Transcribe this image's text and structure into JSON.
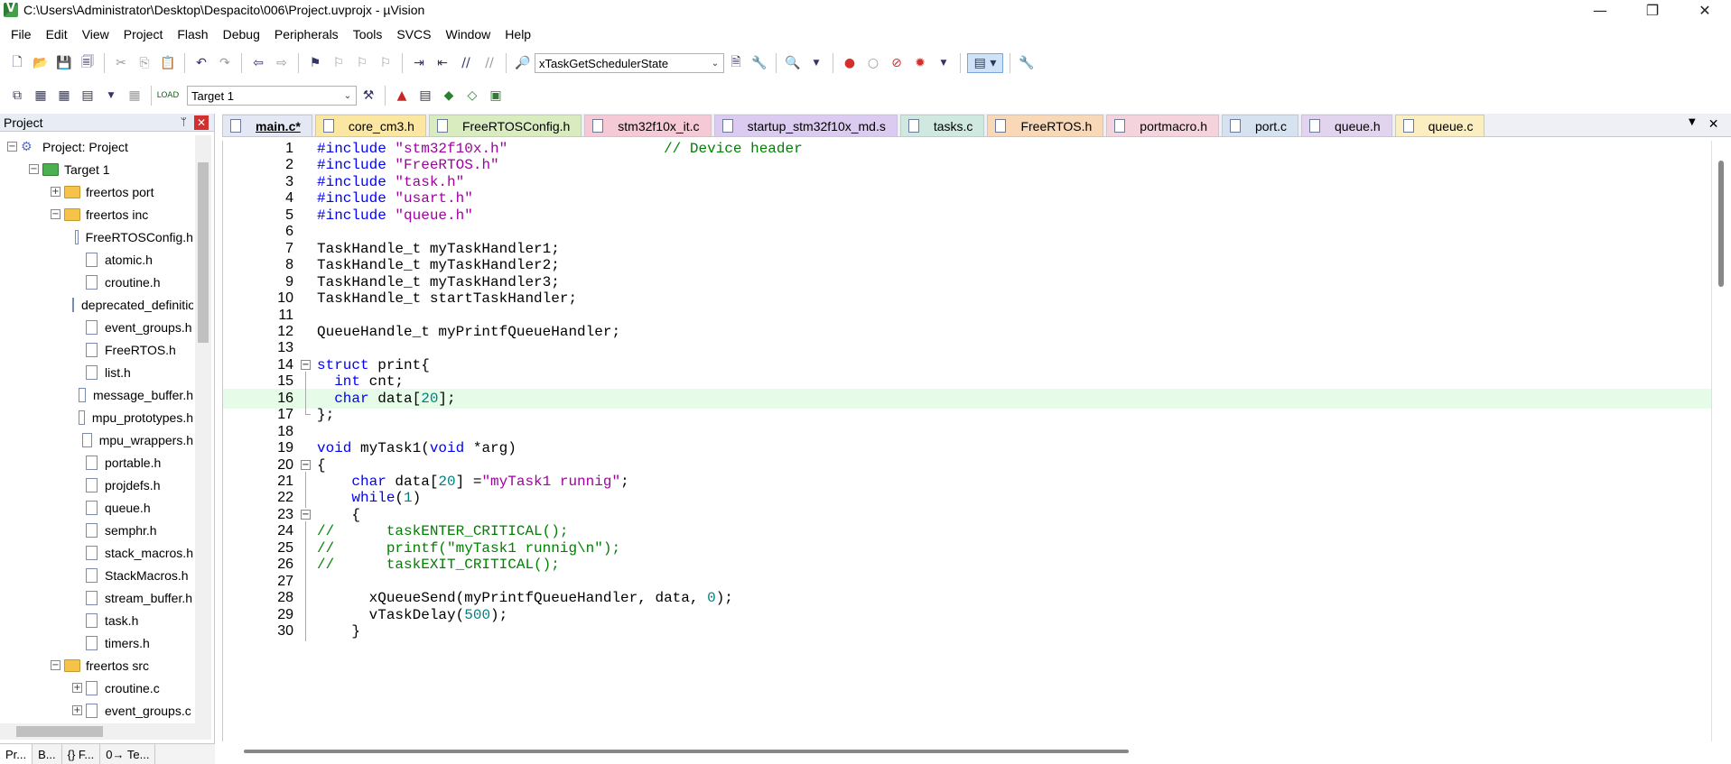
{
  "window": {
    "title": "C:\\Users\\Administrator\\Desktop\\Despacito\\006\\Project.uvprojx - µVision",
    "minimize": "—",
    "maximize": "❐",
    "close": "✕"
  },
  "menu": [
    "File",
    "Edit",
    "View",
    "Project",
    "Flash",
    "Debug",
    "Peripherals",
    "Tools",
    "SVCS",
    "Window",
    "Help"
  ],
  "toolbar": {
    "function_combo": "xTaskGetSchedulerState",
    "target_combo": "Target 1"
  },
  "project_panel": {
    "title": "Project",
    "pin": "ᛘ",
    "close": "✕",
    "tree": [
      {
        "label": "Project: Project",
        "type": "project",
        "indent": 0,
        "expander": "⊟"
      },
      {
        "label": "Target 1",
        "type": "target",
        "indent": 1,
        "expander": "⊟"
      },
      {
        "label": "freertos port",
        "type": "folder",
        "indent": 2,
        "expander": "+"
      },
      {
        "label": "freertos inc",
        "type": "folder",
        "indent": 2,
        "expander": "−"
      },
      {
        "label": "FreeRTOSConfig.h",
        "type": "file",
        "indent": 3
      },
      {
        "label": "atomic.h",
        "type": "file",
        "indent": 3
      },
      {
        "label": "croutine.h",
        "type": "file",
        "indent": 3
      },
      {
        "label": "deprecated_definitions.h",
        "type": "file",
        "indent": 3
      },
      {
        "label": "event_groups.h",
        "type": "file",
        "indent": 3
      },
      {
        "label": "FreeRTOS.h",
        "type": "file",
        "indent": 3
      },
      {
        "label": "list.h",
        "type": "file",
        "indent": 3
      },
      {
        "label": "message_buffer.h",
        "type": "file",
        "indent": 3
      },
      {
        "label": "mpu_prototypes.h",
        "type": "file",
        "indent": 3
      },
      {
        "label": "mpu_wrappers.h",
        "type": "file",
        "indent": 3
      },
      {
        "label": "portable.h",
        "type": "file",
        "indent": 3
      },
      {
        "label": "projdefs.h",
        "type": "file",
        "indent": 3
      },
      {
        "label": "queue.h",
        "type": "file",
        "indent": 3
      },
      {
        "label": "semphr.h",
        "type": "file",
        "indent": 3
      },
      {
        "label": "stack_macros.h",
        "type": "file",
        "indent": 3
      },
      {
        "label": "StackMacros.h",
        "type": "file",
        "indent": 3
      },
      {
        "label": "stream_buffer.h",
        "type": "file",
        "indent": 3
      },
      {
        "label": "task.h",
        "type": "file",
        "indent": 3
      },
      {
        "label": "timers.h",
        "type": "file",
        "indent": 3
      },
      {
        "label": "freertos src",
        "type": "folder",
        "indent": 2,
        "expander": "−"
      },
      {
        "label": "croutine.c",
        "type": "file",
        "indent": 3,
        "expander": "+"
      },
      {
        "label": "event_groups.c",
        "type": "file",
        "indent": 3,
        "expander": "+"
      }
    ],
    "bottom_tabs": [
      "Pr...",
      "B...",
      "{} F...",
      "0→ Te..."
    ]
  },
  "editor_tabs": [
    {
      "label": "main.c*",
      "color": "#e3e8f4",
      "active": true
    },
    {
      "label": "core_cm3.h",
      "color": "#fbe7a1",
      "active": false
    },
    {
      "label": "FreeRTOSConfig.h",
      "color": "#d9ecc0",
      "active": false
    },
    {
      "label": "stm32f10x_it.c",
      "color": "#f6c9d6",
      "active": false
    },
    {
      "label": "startup_stm32f10x_md.s",
      "color": "#dccbf0",
      "active": false
    },
    {
      "label": "tasks.c",
      "color": "#cfe8e0",
      "active": false
    },
    {
      "label": "FreeRTOS.h",
      "color": "#f9d8b8",
      "active": false
    },
    {
      "label": "portmacro.h",
      "color": "#f5d3dd",
      "active": false
    },
    {
      "label": "port.c",
      "color": "#d6e2f0",
      "active": false
    },
    {
      "label": "queue.h",
      "color": "#e2d4ee",
      "active": false
    },
    {
      "label": "queue.c",
      "color": "#fbeec0",
      "active": false
    }
  ],
  "tab_controls": {
    "dropdown": "▼",
    "close": "✕"
  },
  "code": [
    {
      "n": "1",
      "fold": "",
      "html": "<span class='pp'>#include</span> <span class='str'>\"stm32f10x.h\"</span>                  <span class='cmt'>// Device header</span>"
    },
    {
      "n": "2",
      "fold": "",
      "html": "<span class='pp'>#include</span> <span class='str'>\"FreeRTOS.h\"</span>"
    },
    {
      "n": "3",
      "fold": "",
      "html": "<span class='pp'>#include</span> <span class='str'>\"task.h\"</span>"
    },
    {
      "n": "4",
      "fold": "",
      "html": "<span class='pp'>#include</span> <span class='str'>\"usart.h\"</span>"
    },
    {
      "n": "5",
      "fold": "",
      "html": "<span class='pp'>#include</span> <span class='str'>\"queue.h\"</span>"
    },
    {
      "n": "6",
      "fold": "",
      "html": ""
    },
    {
      "n": "7",
      "fold": "",
      "html": "TaskHandle_t myTaskHandler1;"
    },
    {
      "n": "8",
      "fold": "",
      "html": "TaskHandle_t myTaskHandler2;"
    },
    {
      "n": "9",
      "fold": "",
      "html": "TaskHandle_t myTaskHandler3;"
    },
    {
      "n": "10",
      "fold": "",
      "html": "TaskHandle_t startTaskHandler;"
    },
    {
      "n": "11",
      "fold": "",
      "html": ""
    },
    {
      "n": "12",
      "fold": "",
      "html": "QueueHandle_t myPrintfQueueHandler;"
    },
    {
      "n": "13",
      "fold": "",
      "html": ""
    },
    {
      "n": "14",
      "fold": "open",
      "html": "<span class='kw'>struct</span> print{"
    },
    {
      "n": "15",
      "fold": "line",
      "html": "  <span class='kw'>int</span> cnt;"
    },
    {
      "n": "16",
      "fold": "line",
      "html": "  <span class='kw'>char</span> data[<span class='num'>20</span>];",
      "highlight": true
    },
    {
      "n": "17",
      "fold": "end",
      "html": "};"
    },
    {
      "n": "18",
      "fold": "",
      "html": ""
    },
    {
      "n": "19",
      "fold": "",
      "html": "<span class='kw'>void</span> myTask1(<span class='kw'>void</span> *arg)"
    },
    {
      "n": "20",
      "fold": "open",
      "html": "{"
    },
    {
      "n": "21",
      "fold": "line",
      "html": "    <span class='kw'>char</span> data[<span class='num'>20</span>] =<span class='str'>\"myTask1 runnig\"</span>;"
    },
    {
      "n": "22",
      "fold": "line",
      "html": "    <span class='kw'>while</span>(<span class='num'>1</span>)"
    },
    {
      "n": "23",
      "fold": "open",
      "html": "    {"
    },
    {
      "n": "24",
      "fold": "line",
      "html": "<span class='cmt'>//      taskENTER_CRITICAL();</span>"
    },
    {
      "n": "25",
      "fold": "line",
      "html": "<span class='cmt'>//      printf(\"myTask1 runnig\\n\");</span>"
    },
    {
      "n": "26",
      "fold": "line",
      "html": "<span class='cmt'>//      taskEXIT_CRITICAL();</span>"
    },
    {
      "n": "27",
      "fold": "line",
      "html": ""
    },
    {
      "n": "28",
      "fold": "line",
      "html": "      xQueueSend(myPrintfQueueHandler, data, <span class='num'>0</span>);"
    },
    {
      "n": "29",
      "fold": "line",
      "html": "      vTaskDelay(<span class='num'>500</span>);"
    },
    {
      "n": "30",
      "fold": "line",
      "html": "    }"
    }
  ]
}
